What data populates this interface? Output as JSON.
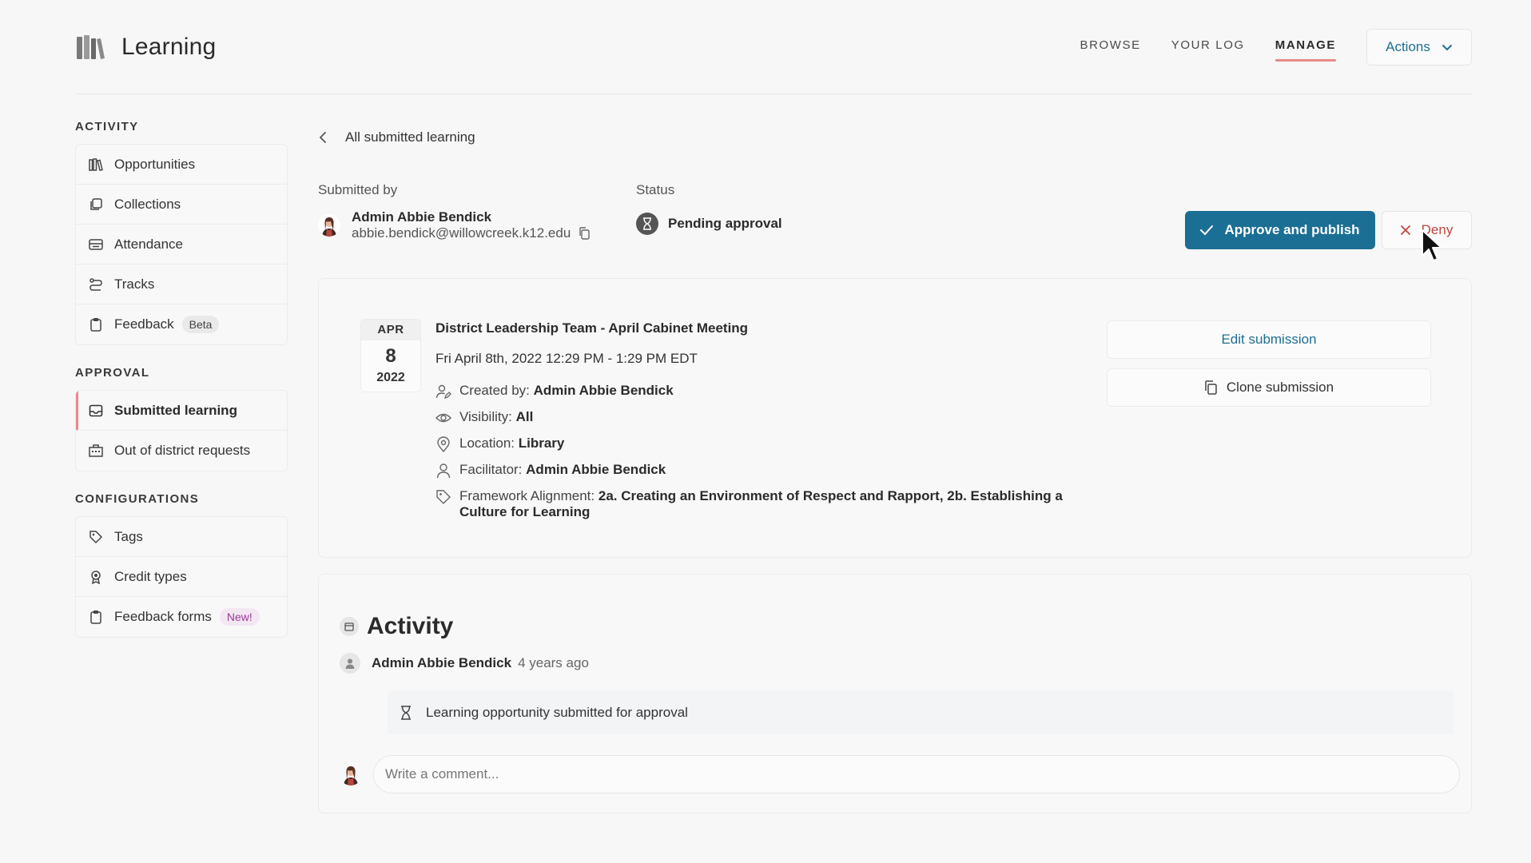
{
  "app": {
    "title": "Learning"
  },
  "nav": {
    "browse": "BROWSE",
    "your_log": "YOUR LOG",
    "manage": "MANAGE",
    "actions": "Actions"
  },
  "sidebar": {
    "activity_title": "ACTIVITY",
    "activity_items": [
      {
        "label": "Opportunities",
        "icon": "books-icon"
      },
      {
        "label": "Collections",
        "icon": "collections-icon"
      },
      {
        "label": "Attendance",
        "icon": "attendance-icon"
      },
      {
        "label": "Tracks",
        "icon": "tracks-icon"
      },
      {
        "label": "Feedback",
        "icon": "clipboard-icon",
        "badge": "Beta"
      }
    ],
    "approval_title": "APPROVAL",
    "approval_items": [
      {
        "label": "Submitted learning",
        "icon": "inbox-icon",
        "active": true
      },
      {
        "label": "Out of district requests",
        "icon": "building-icon"
      }
    ],
    "config_title": "CONFIGURATIONS",
    "config_items": [
      {
        "label": "Tags",
        "icon": "tags-icon"
      },
      {
        "label": "Credit types",
        "icon": "award-icon"
      },
      {
        "label": "Feedback forms",
        "icon": "clipboard-icon",
        "badge": "New!"
      }
    ]
  },
  "main": {
    "back_label": "All submitted learning",
    "submitted_by_label": "Submitted by",
    "submitter_name": "Admin Abbie Bendick",
    "submitter_email": "abbie.bendick@willowcreek.k12.edu",
    "status_label": "Status",
    "status_value": "Pending approval",
    "approve_label": "Approve and publish",
    "deny_label": "Deny"
  },
  "event": {
    "month": "APR",
    "day": "8",
    "year": "2022",
    "title": "District Leadership Team - April Cabinet Meeting",
    "time": "Fri April 8th, 2022 12:29 PM - 1:29 PM EDT",
    "created_by_label": "Created by:",
    "created_by": "Admin Abbie Bendick",
    "visibility_label": "Visibility:",
    "visibility": "All",
    "location_label": "Location:",
    "location": "Library",
    "facilitator_label": "Facilitator:",
    "facilitator": "Admin Abbie Bendick",
    "framework_label": "Framework Alignment:",
    "framework": "2a. Creating an Environment of Respect and Rapport, 2b. Establishing a Culture for Learning",
    "edit_label": "Edit submission",
    "clone_label": "Clone submission"
  },
  "activity": {
    "title": "Activity",
    "user": "Admin Abbie Bendick",
    "time_ago": "4 years ago",
    "event_text": "Learning opportunity submitted for approval",
    "comment_placeholder": "Write a comment..."
  },
  "colors": {
    "primary": "#1b6f94",
    "accent": "#e98a86",
    "deny": "#c0453f"
  }
}
